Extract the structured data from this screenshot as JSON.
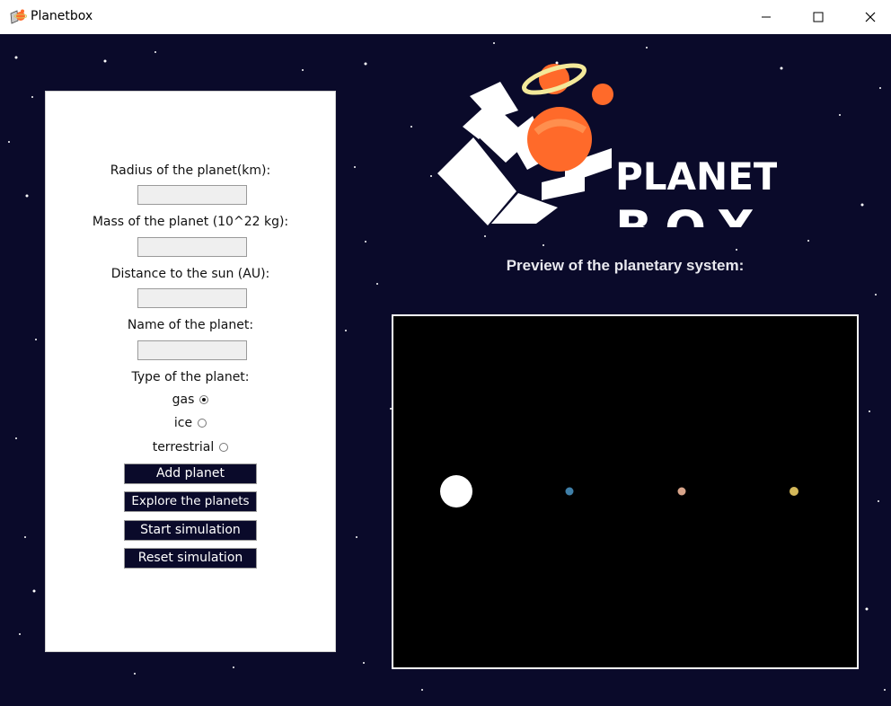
{
  "window": {
    "title": "Planetbox",
    "icon": "planetbox-app-icon",
    "controls": [
      "minimize-icon",
      "maximize-icon",
      "close-icon"
    ]
  },
  "form": {
    "radius_label": "Radius of the planet(km):",
    "radius_value": "",
    "mass_label": "Mass of the planet (10^22 kg):",
    "mass_value": "",
    "distance_label": "Distance to the sun (AU):",
    "distance_value": "",
    "name_label": "Name of the planet:",
    "name_value": "",
    "type_label": "Type of the planet:",
    "types": [
      {
        "label": "gas",
        "selected": true
      },
      {
        "label": "ice",
        "selected": false
      },
      {
        "label": "terrestrial",
        "selected": false
      }
    ]
  },
  "buttons": {
    "add": "Add planet",
    "explore": "Explore the planets",
    "start": "Start simulation",
    "reset": "Reset simulation"
  },
  "logo": {
    "line1": "PLANET",
    "line2": "BOX"
  },
  "preview": {
    "title": "Preview of the planetary system:",
    "bodies": [
      {
        "name": "sun",
        "color": "#ffffff"
      },
      {
        "name": "planet-1",
        "color": "#3f7fa8"
      },
      {
        "name": "planet-2",
        "color": "#d8a48a"
      },
      {
        "name": "planet-3",
        "color": "#d4b85a"
      }
    ]
  },
  "colors": {
    "background": "#0a0a2a",
    "accent": "#ff6a2a",
    "ring": "#f3e99a"
  }
}
